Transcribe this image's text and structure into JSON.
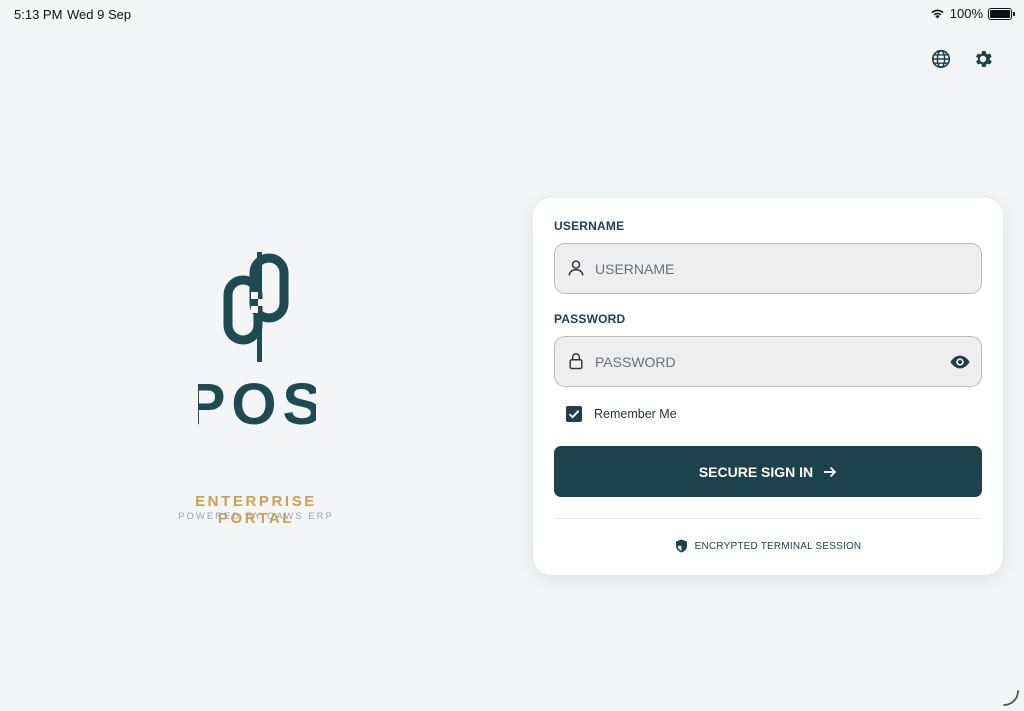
{
  "status_bar": {
    "time": "5:13 PM",
    "date": "Wed 9 Sep",
    "battery": "100%",
    "battery_level": 1.0
  },
  "top_actions": {
    "language_icon": "globe-icon",
    "settings_icon": "gear-icon"
  },
  "brand": {
    "logo": "POS",
    "title": "ENTERPRISE PORTAL",
    "subtitle": "POWERED BY QAWS ERP"
  },
  "login": {
    "username_label": "USERNAME",
    "username_placeholder": "USERNAME",
    "username_value": "",
    "password_label": "PASSWORD",
    "password_placeholder": "PASSWORD",
    "password_value": "",
    "remember_label": "Remember Me",
    "remember_checked": true,
    "signin_label": "SECURE SIGN IN",
    "secure_note": "ENCRYPTED TERMINAL SESSION"
  },
  "colors": {
    "accent": "#1e424c",
    "gold": "#c9a24e",
    "background": "#f3f5f7"
  }
}
